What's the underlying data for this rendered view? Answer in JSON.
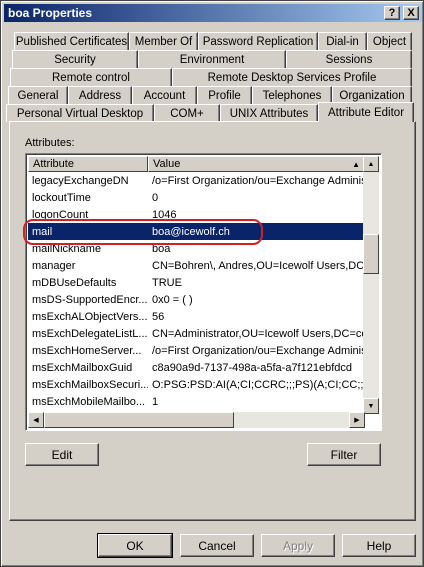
{
  "window": {
    "title": "boa Properties"
  },
  "titlebar_buttons": {
    "help": "?",
    "close": "X"
  },
  "tabs_row1": [
    "Published Certificates",
    "Member Of",
    "Password Replication",
    "Dial-in",
    "Object"
  ],
  "tabs_row2": [
    "Security",
    "Environment",
    "Sessions"
  ],
  "tabs_row3": [
    "Remote control",
    "Remote Desktop Services Profile"
  ],
  "tabs_row4": [
    "General",
    "Address",
    "Account",
    "Profile",
    "Telephones",
    "Organization"
  ],
  "tabs_row5": [
    "Personal Virtual Desktop",
    "COM+",
    "UNIX Attributes",
    "Attribute Editor"
  ],
  "attributes_label": "Attributes:",
  "list": {
    "columns": [
      "Attribute",
      "Value"
    ],
    "rows": [
      {
        "attr": "legacyExchangeDN",
        "value": "/o=First Organization/ou=Exchange Administ"
      },
      {
        "attr": "lockoutTime",
        "value": "0"
      },
      {
        "attr": "logonCount",
        "value": "1046"
      },
      {
        "attr": "mail",
        "value": "boa@icewolf.ch"
      },
      {
        "attr": "mailNickname",
        "value": "boa"
      },
      {
        "attr": "manager",
        "value": "CN=Bohren\\, Andres,OU=Icewolf Users,DC=i"
      },
      {
        "attr": "mDBUseDefaults",
        "value": "TRUE"
      },
      {
        "attr": "msDS-SupportedEncr...",
        "value": "0x0 = ( )"
      },
      {
        "attr": "msExchALObjectVers...",
        "value": "56"
      },
      {
        "attr": "msExchDelegateListL...",
        "value": "CN=Administrator,OU=Icewolf Users,DC=cor"
      },
      {
        "attr": "msExchHomeServer...",
        "value": "/o=First Organization/ou=Exchange Administ"
      },
      {
        "attr": "msExchMailboxGuid",
        "value": "c8a90a9d-7137-498a-a5fa-a7f121ebfdcd"
      },
      {
        "attr": "msExchMailboxSecuri...",
        "value": "O:PSG:PSD:AI(A;CI;CCRC;;;PS)(A;CI;CC;;;LA"
      },
      {
        "attr": "msExchMobileMailbo...",
        "value": "1"
      }
    ],
    "selected_index": 3
  },
  "buttons": {
    "edit": "Edit",
    "filter": "Filter",
    "ok": "OK",
    "cancel": "Cancel",
    "apply": "Apply",
    "help": "Help"
  }
}
